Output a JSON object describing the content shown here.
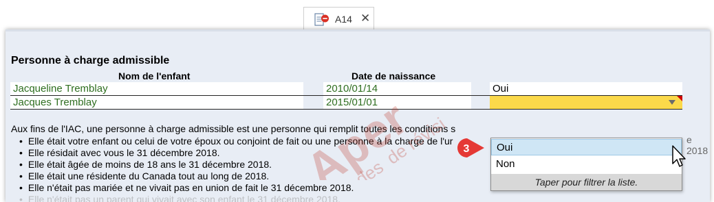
{
  "tab": {
    "label": "A14",
    "close_label": "✕",
    "icon": "document-form-icon"
  },
  "form": {
    "title": "Personne à charge admissible",
    "col_name": "Nom de l'enfant",
    "col_date": "Date de naissance",
    "rows": [
      {
        "name": "Jacqueline Tremblay",
        "date": "2010/01/14",
        "answer": "Oui"
      },
      {
        "name": "Jacques Tremblay",
        "date": "2015/01/01",
        "answer": ""
      }
    ]
  },
  "paragraph": "Aux fins de l'IAC, une personne à charge admissible est une personne qui remplit toutes les conditions s",
  "bullets": [
    "Elle était votre enfant ou celui de votre époux ou conjoint de fait ou une personne à la charge de l'ur",
    "Elle résidait avec vous le 31 décembre 2018.",
    "Elle était âgée de moins de 18 ans le 31 décembre 2018.",
    "Elle était une résidente du Canada tout au long de 2018.",
    "Elle n'était pas mariée et ne vivait pas en union de fait le 31 décembre 2018.",
    "Elle n'était pas un parent qui vivait avec son enfant le 31 décembre 2018."
  ],
  "overflow_text": "e 2018",
  "dropdown": {
    "options": [
      "Oui",
      "Non"
    ],
    "selected": "Oui",
    "hint": "Taper pour filtrer la liste."
  },
  "step_badge": "3",
  "watermark": {
    "main": "Aper",
    "sub": "des",
    "sub2": "de révisi"
  },
  "colors": {
    "name_green": "#2e6e1f",
    "badge_red": "#e53935",
    "highlight_yellow": "#fbd94a",
    "selection_blue": "#cfe6f5"
  }
}
